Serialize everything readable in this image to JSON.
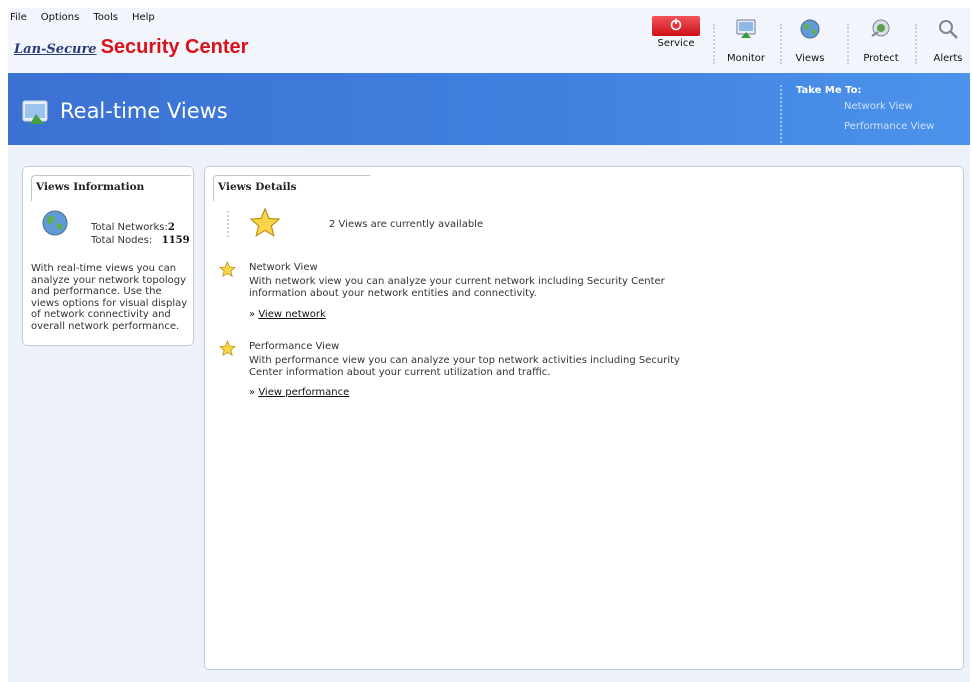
{
  "menu": [
    "File",
    "Options",
    "Tools",
    "Help"
  ],
  "brand": {
    "prefix": "Lan-Secure",
    "name": "Security Center"
  },
  "toolbar": [
    {
      "label": "Service",
      "icon": "power-icon"
    },
    {
      "label": "Monitor",
      "icon": "monitor-icon"
    },
    {
      "label": "Views",
      "icon": "globe-icon"
    },
    {
      "label": "Protect",
      "icon": "protect-icon"
    },
    {
      "label": "Alerts",
      "icon": "alerts-icon"
    }
  ],
  "banner": {
    "title": "Real-time Views",
    "take_me_to": {
      "heading": "Take Me To:",
      "links": [
        "Network View",
        "Performance View"
      ]
    }
  },
  "views_info": {
    "title": "Views Information",
    "total_networks_label": "Total Networks:",
    "total_networks": "2",
    "total_nodes_label": "Total Nodes:",
    "total_nodes": "1159",
    "description": "With real-time views you can analyze your network topology and performance. Use the views options for visual display of network connectivity and overall network performance."
  },
  "views_details": {
    "title": "Views Details",
    "availability": "2 Views are currently available",
    "items": [
      {
        "name": "Network View",
        "description": "With network view you can analyze your current network including Security Center information about your network entities and connectivity.",
        "link": "View network"
      },
      {
        "name": "Performance View",
        "description": "With performance view you can analyze your top network activities including Security Center information about your current utilization and traffic.",
        "link": "View performance"
      }
    ]
  },
  "colors": {
    "accent": "#3f80df",
    "brand_red": "#d8121b",
    "service_red": "#e0232b"
  }
}
